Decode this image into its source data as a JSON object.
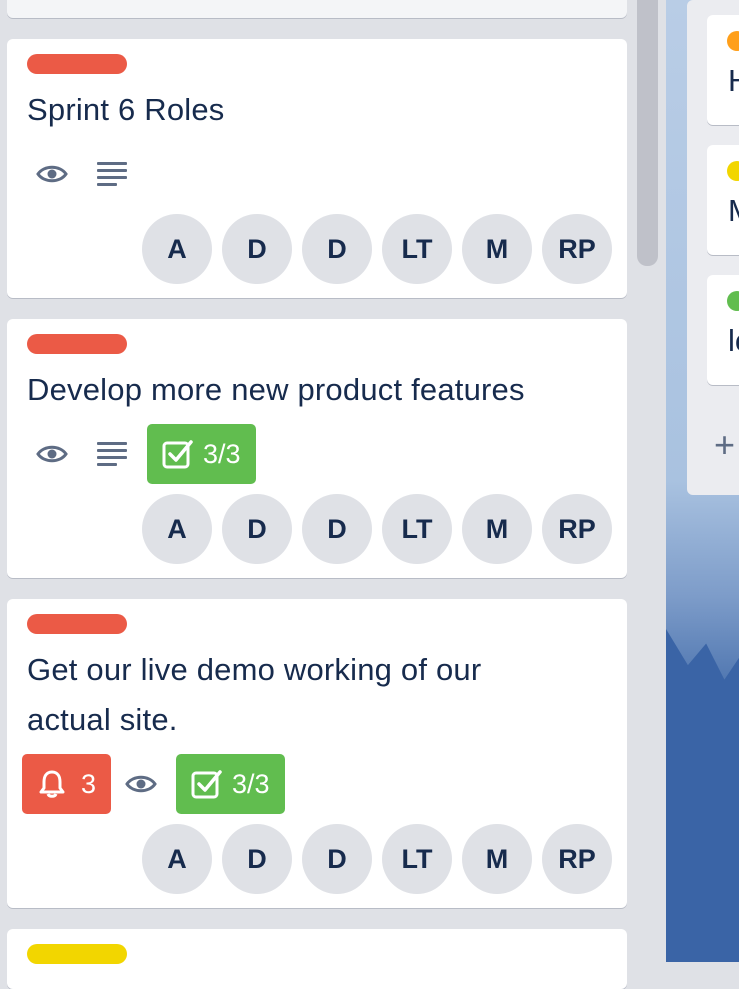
{
  "colors": {
    "label_red": "#eb5a46",
    "label_yellow": "#f2d600",
    "label_orange": "#ff9f1a",
    "label_green": "#61bd4f",
    "checklist_green": "#61bd4f",
    "due_red": "#eb5a46"
  },
  "cards": [
    {
      "title": "Sprint 6 Roles",
      "label_color": "#eb5a46",
      "badges": {
        "watch_icon": "eye-icon",
        "description_icon": "description-icon"
      },
      "members": [
        "A",
        "D",
        "D",
        "LT",
        "M",
        "RP"
      ]
    },
    {
      "title": "Develop more new product features",
      "label_color": "#eb5a46",
      "badges": {
        "watch_icon": "eye-icon",
        "description_icon": "description-icon",
        "checklist": "3/3"
      },
      "members": [
        "A",
        "D",
        "D",
        "LT",
        "M",
        "RP"
      ]
    },
    {
      "title": "Get our live demo working of our actual site.",
      "title_line1": "Get our live demo working of our",
      "title_line2": "actual site.",
      "label_color": "#eb5a46",
      "badges": {
        "due_icon": "bell-icon",
        "due_count": "3",
        "watch_icon": "eye-icon",
        "checklist": "3/3"
      },
      "members": [
        "A",
        "D",
        "D",
        "LT",
        "M",
        "RP"
      ]
    },
    {
      "label_color": "#f2d600"
    }
  ],
  "right_list": {
    "cards": [
      {
        "label_color": "#ff9f1a",
        "text_fragment": "H"
      },
      {
        "label_color": "#f2d600",
        "text_fragment": "M"
      },
      {
        "label_color": "#61bd4f",
        "text_fragment": "lc"
      }
    ],
    "add_icon": "plus-icon"
  }
}
